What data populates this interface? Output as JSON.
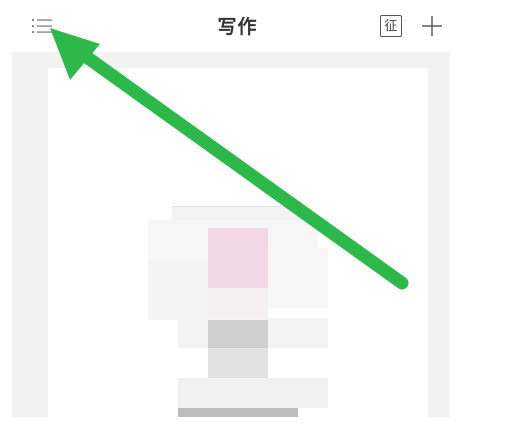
{
  "header": {
    "title": "写作",
    "zheng_icon_glyph": "征"
  },
  "icons": {
    "menu": "list-menu-icon",
    "zheng": "zheng-badge-icon",
    "add": "plus-icon"
  },
  "colors": {
    "panel_bg": "#f2f2f2",
    "annotation_arrow": "#2db84a",
    "blur_pink": "#f2d8e4"
  }
}
